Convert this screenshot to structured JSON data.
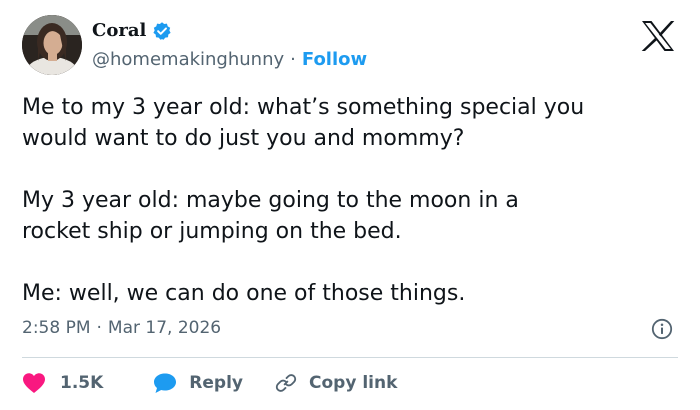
{
  "author": {
    "display_name": "Coral",
    "handle": "@homemakinghunny",
    "separator": "·",
    "follow_label": "Follow"
  },
  "tweet": {
    "text": "Me to my 3 year old: what’s something special you\nwould want to do just you and mommy?\n\nMy 3 year old: maybe going to the moon in a\nrocket ship or jumping on the bed.\n\nMe: well, we can do one of those things.",
    "time": "2:58 PM",
    "separator": "·",
    "date": "Mar 17, 2026"
  },
  "actions": {
    "like_count": "1.5K",
    "reply_label": "Reply",
    "copy_link_label": "Copy link"
  },
  "icons": {
    "verified": "verified-badge-icon",
    "logo": "x-logo-icon",
    "info": "info-icon",
    "like": "heart-icon",
    "reply": "speech-bubble-icon",
    "copy": "link-icon"
  },
  "colors": {
    "accent": "#1d9bf0",
    "like": "#f91880",
    "secondary_text": "#536471",
    "primary_text": "#0f1419"
  }
}
